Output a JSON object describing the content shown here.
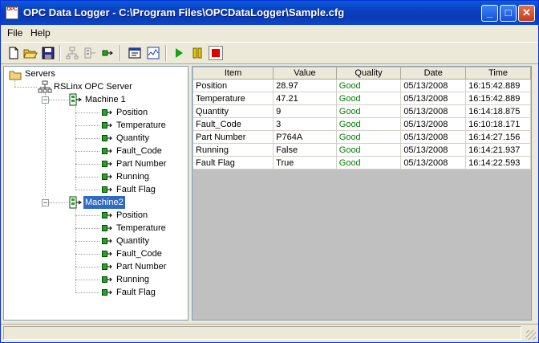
{
  "window": {
    "title": "OPC Data Logger - C:\\Program Files\\OPCDataLogger\\Sample.cfg",
    "app_icon_text": "OPC",
    "minimize_label": "_",
    "maximize_label": "□",
    "close_label": "✕"
  },
  "menu": {
    "file_label": "File",
    "help_label": "Help"
  },
  "toolbar": {
    "buttons": [
      "new",
      "open",
      "save",
      "add-server",
      "add-group",
      "add-item",
      "properties",
      "trend",
      "start",
      "pause",
      "stop"
    ],
    "stop_pressed": true
  },
  "tree": {
    "root_label": "Servers",
    "server_label": "RSLinx OPC Server",
    "machines": [
      {
        "label": "Machine 1",
        "selected": false,
        "tags": [
          "Position",
          "Temperature",
          "Quantity",
          "Fault_Code",
          "Part Number",
          "Running",
          "Fault Flag"
        ]
      },
      {
        "label": "Machine2",
        "selected": true,
        "tags": [
          "Position",
          "Temperature",
          "Quantity",
          "Fault_Code",
          "Part Number",
          "Running",
          "Fault Flag"
        ]
      }
    ]
  },
  "grid": {
    "columns": [
      "Item",
      "Value",
      "Quality",
      "Date",
      "Time"
    ],
    "rows": [
      {
        "item": "Position",
        "value": "28.97",
        "quality": "Good",
        "date": "05/13/2008",
        "time": "16:15:42.889"
      },
      {
        "item": "Temperature",
        "value": "47.21",
        "quality": "Good",
        "date": "05/13/2008",
        "time": "16:15:42.889"
      },
      {
        "item": "Quantity",
        "value": "9",
        "quality": "Good",
        "date": "05/13/2008",
        "time": "16:14:18.875"
      },
      {
        "item": "Fault_Code",
        "value": "3",
        "quality": "Good",
        "date": "05/13/2008",
        "time": "16:10:18.171"
      },
      {
        "item": "Part Number",
        "value": "P764A",
        "quality": "Good",
        "date": "05/13/2008",
        "time": "16:14:27.156"
      },
      {
        "item": "Running",
        "value": "False",
        "quality": "Good",
        "date": "05/13/2008",
        "time": "16:14:21.937"
      },
      {
        "item": "Fault Flag",
        "value": "True",
        "quality": "Good",
        "date": "05/13/2008",
        "time": "16:14:22.593"
      }
    ]
  },
  "status": {
    "text": ""
  },
  "colors": {
    "good": "#008000",
    "selection": "#316ac5",
    "titlebar": "#0a3ab5"
  }
}
